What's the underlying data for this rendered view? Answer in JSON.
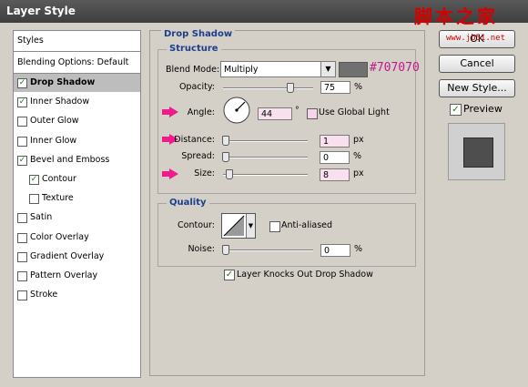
{
  "window": {
    "title": "Layer Style",
    "watermark": "脚本之家",
    "watermark_url": "www.jb51.net"
  },
  "styles_list": {
    "header": "Styles",
    "blending": "Blending Options: Default",
    "items": [
      {
        "label": "Drop Shadow",
        "checked": true,
        "selected": true
      },
      {
        "label": "Inner Shadow",
        "checked": true
      },
      {
        "label": "Outer Glow",
        "checked": false
      },
      {
        "label": "Inner Glow",
        "checked": false
      },
      {
        "label": "Bevel and Emboss",
        "checked": true
      },
      {
        "label": "Contour",
        "checked": true,
        "sub": true
      },
      {
        "label": "Texture",
        "checked": false,
        "sub": true
      },
      {
        "label": "Satin",
        "checked": false
      },
      {
        "label": "Color Overlay",
        "checked": false
      },
      {
        "label": "Gradient Overlay",
        "checked": false
      },
      {
        "label": "Pattern Overlay",
        "checked": false
      },
      {
        "label": "Stroke",
        "checked": false
      }
    ]
  },
  "drop_shadow": {
    "title": "Drop Shadow",
    "structure": {
      "title": "Structure",
      "blend_mode_label": "Blend Mode:",
      "blend_mode_value": "Multiply",
      "color_hex": "#707070",
      "color_annotation": "#707070",
      "opacity_label": "Opacity:",
      "opacity_value": "75",
      "opacity_unit": "%",
      "opacity_fraction": 0.75,
      "angle_label": "Angle:",
      "angle_value": "44",
      "angle_unit": "°",
      "use_global_light": "Use Global Light",
      "use_global_light_checked": false,
      "distance_label": "Distance:",
      "distance_value": "1",
      "distance_unit": "px",
      "spread_label": "Spread:",
      "spread_value": "0",
      "spread_unit": "%",
      "size_label": "Size:",
      "size_value": "8",
      "size_unit": "px"
    },
    "quality": {
      "title": "Quality",
      "contour_label": "Contour:",
      "anti_aliased": "Anti-aliased",
      "anti_aliased_checked": false,
      "noise_label": "Noise:",
      "noise_value": "0",
      "noise_unit": "%"
    },
    "knocks_out": "Layer Knocks Out Drop Shadow",
    "knocks_out_checked": true
  },
  "buttons": {
    "ok": "OK",
    "cancel": "Cancel",
    "new_style": "New Style...",
    "preview_label": "Preview",
    "preview_checked": true
  },
  "colors": {
    "accent_arrow": "#ee1b8c",
    "annotation_text": "#c0188c",
    "title_blue": "#1c3f8c",
    "shadow_swatch": "#707070"
  }
}
